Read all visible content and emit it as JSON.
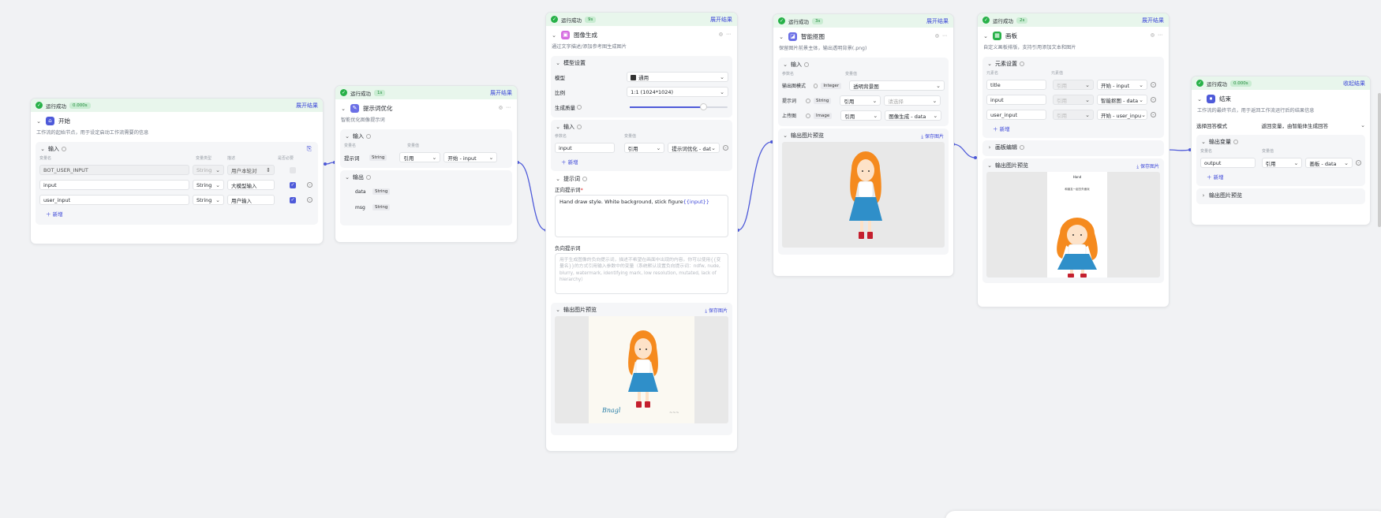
{
  "status_text": "运行成功",
  "expand_label": "展开结果",
  "collapse_label": "收起结果",
  "add_label": "新增",
  "save_image_label": "保存图片",
  "output_preview_label": "输出图片预览",
  "ref_label": "引用",
  "string_type": "String",
  "start": {
    "time": "0.000s",
    "title": "开始",
    "desc": "工作流的起始节点，用于设定启动工作流需要的信息",
    "section": "输入",
    "col_headers": [
      "变量名",
      "变量类型",
      "描述",
      "是否必要"
    ],
    "rows": [
      {
        "name": "BOT_USER_INPUT",
        "type": "String",
        "desc": "用户本轮对",
        "required": false
      },
      {
        "name": "input",
        "type": "String",
        "desc": "大模型输入",
        "required": true
      },
      {
        "name": "user_input",
        "type": "String",
        "desc": "用户输入",
        "required": true
      }
    ]
  },
  "prompt_opt": {
    "time": "1s",
    "title": "提示词优化",
    "desc": "智能优化图像提示词",
    "input_section": "输入",
    "col_headers": [
      "变量名",
      "变量值"
    ],
    "row_label": "提示词",
    "row_ref": "引用",
    "row_val": "开始 - input",
    "output_section": "输出",
    "outputs": [
      {
        "name": "data",
        "type": "String"
      },
      {
        "name": "msg",
        "type": "String"
      }
    ]
  },
  "image_gen": {
    "time": "9s",
    "title": "图像生成",
    "desc": "通过文字描述/添加参考图生成图片",
    "model_section": "模型设置",
    "model_label": "模型",
    "model_value": "通用",
    "ratio_label": "比例",
    "ratio_value": "1:1 (1024*1024)",
    "quality_label": "生成质量",
    "quality_level": 0.75,
    "input_section": "输入",
    "col_headers": [
      "参数名",
      "变量值"
    ],
    "input_name": "input",
    "input_ref": "引用",
    "input_val": "提示词优化 - dat",
    "prompt_section": "提示词",
    "pos_label": "正向提示词",
    "pos_text": "Hand draw style. White background, stick figure",
    "pos_var": "{{input}}",
    "neg_label": "负向提示词",
    "neg_text": "用于生成图像的负向提示词，描述不希望在画面中出现的内容。你可以使用{{变量名}}的方式引用输入参数中的变量（系统默认设置负向提示词：ndfw, nude, blurry, watermark, identifying mark, low resolution, mutated, lack of hierarchy）",
    "preview": "输出图片预览",
    "save": "保存图片"
  },
  "matting": {
    "time": "3s",
    "title": "智能抠图",
    "desc": "保留图片前景主体，输出透明背景(.png)",
    "input_section": "输入",
    "col_headers": [
      "参数名",
      "变量值"
    ],
    "rows": [
      {
        "label": "输出图模式",
        "type": "Integer",
        "ref": "透明背景图",
        "val": ""
      },
      {
        "label": "提示词",
        "type": "String",
        "ref": "引用",
        "val": "请选择"
      },
      {
        "label": "上传图",
        "type": "Image",
        "ref": "引用",
        "val": "图像生成 - data"
      }
    ],
    "preview": "输出图片预览",
    "save": "保存图片"
  },
  "canvas": {
    "time": "2s",
    "title": "画板",
    "desc": "自定义画板排版，支持引用添加文本和图片",
    "elem_section": "元素设置",
    "col_headers": [
      "元素名",
      "元素值"
    ],
    "rows": [
      {
        "name": "title",
        "ref": "引用",
        "val": "开始 - input"
      },
      {
        "name": "input",
        "ref": "引用",
        "val": "智能抠图 - data"
      },
      {
        "name": "user_input",
        "ref": "引用",
        "val": "开始 - user_inpu"
      }
    ],
    "board_section": "画板编辑",
    "preview": "输出图片预览",
    "save": "保存图片",
    "poster_title": "Hand",
    "poster_sub": "和朋友一起去外面玩"
  },
  "end": {
    "time": "0.000s",
    "title": "结束",
    "desc": "工作流的最终节点，用于返回工作流运行后的结果信息",
    "mode_label": "选择回答模式",
    "mode_value": "返回变量，由智能体生成回答",
    "out_section": "输出变量",
    "col_headers": [
      "变量名",
      "变量值"
    ],
    "out_name": "output",
    "out_ref": "引用",
    "out_val": "画板 - data",
    "preview_section": "输出图片预览"
  },
  "colors": {
    "accent": "#3d48d8",
    "success": "#27b148",
    "status_bg": "#e8f6ec"
  }
}
